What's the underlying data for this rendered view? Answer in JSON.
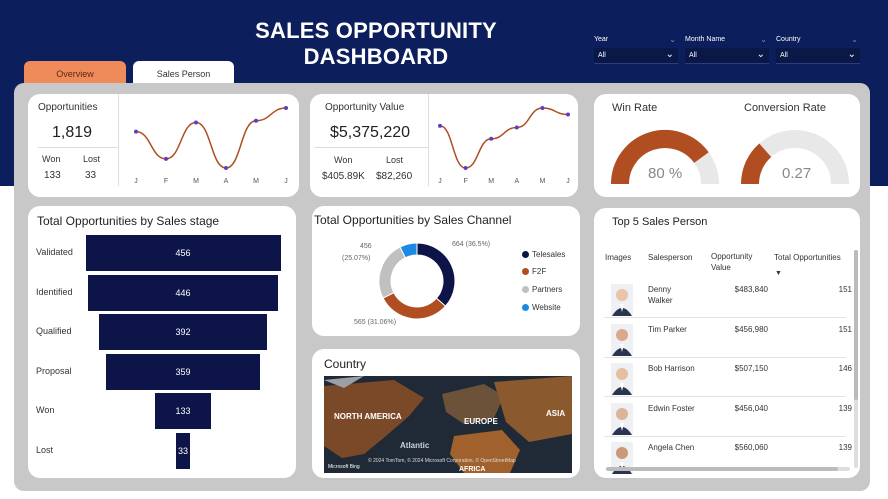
{
  "header": {
    "title": "SALES OPPORTUNITY DASHBOARD"
  },
  "filters": [
    {
      "label": "Year",
      "value": "All"
    },
    {
      "label": "Month Name",
      "value": "All"
    },
    {
      "label": "Country",
      "value": "All"
    }
  ],
  "tabs": {
    "overview": "Overview",
    "sales_person": "Sales Person"
  },
  "opportunities": {
    "title": "Opportunities",
    "value": "1,819",
    "won_label": "Won",
    "won_value": "133",
    "lost_label": "Lost",
    "lost_value": "33"
  },
  "opportunity_value": {
    "title": "Opportunity Value",
    "value": "$5,375,220",
    "won_label": "Won",
    "won_value": "$405.89K",
    "lost_label": "Lost",
    "lost_value": "$82,260"
  },
  "rates": {
    "win_title": "Win Rate",
    "win_value": "80 %",
    "win_fraction": 0.8,
    "conv_title": "Conversion Rate",
    "conv_value": "0.27",
    "conv_fraction": 0.27
  },
  "funnel": {
    "title": "Total Opportunities by Sales stage",
    "stages": [
      {
        "label": "Validated",
        "value": "456"
      },
      {
        "label": "Identified",
        "value": "446"
      },
      {
        "label": "Qualified",
        "value": "392"
      },
      {
        "label": "Proposal",
        "value": "359"
      },
      {
        "label": "Won",
        "value": "133"
      },
      {
        "label": "Lost",
        "value": "33"
      }
    ]
  },
  "channel": {
    "title": "Total Opportunities by Sales Channel",
    "label_top_right": "664 (36.5%)",
    "label_top_left_1": "456",
    "label_top_left_2": "(25.07%)",
    "label_bottom": "565 (31.06%)",
    "legend": [
      "Telesales",
      "F2F",
      "Partners",
      "Website"
    ]
  },
  "country": {
    "title": "Country",
    "labels": {
      "na": "NORTH AMERICA",
      "eu": "EUROPE",
      "as": "ASIA",
      "at": "Atlantic",
      "af": "AFRICA"
    },
    "attribution": "© 2024 TomTom, © 2024 Microsoft Corporation, © OpenStreetMap",
    "logo": "Microsoft Bing"
  },
  "top5": {
    "title": "Top 5 Sales Person",
    "headers": {
      "images": "Images",
      "salesperson": "Salesperson",
      "value_1": "Opportunity",
      "value_2": "Value",
      "total": "Total Opportunities"
    },
    "rows": [
      {
        "name_1": "Denny",
        "name_2": "Walker",
        "value": "$483,840",
        "total": "151"
      },
      {
        "name_1": "Tim Parker",
        "name_2": "",
        "value": "$456,980",
        "total": "151"
      },
      {
        "name_1": "Bob Harrison",
        "name_2": "",
        "value": "$507,150",
        "total": "146"
      },
      {
        "name_1": "Edwin Foster",
        "name_2": "",
        "value": "$456,040",
        "total": "139"
      },
      {
        "name_1": "Angela Chen",
        "name_2": "",
        "value": "$560,060",
        "total": "139"
      }
    ]
  },
  "month_axis": [
    "J",
    "F",
    "M",
    "A",
    "M",
    "J"
  ],
  "colors": {
    "navy": "#0c1e5b",
    "orange_tab": "#ef8b5b",
    "rust": "#b04d21",
    "funnel": "#0c1448",
    "donut": [
      "#0c1448",
      "#b04d21",
      "#c0c0c0",
      "#1e88e5"
    ]
  },
  "chart_data": [
    {
      "type": "line",
      "title": "",
      "categories": [
        "J",
        "F",
        "M",
        "A",
        "M",
        "J"
      ],
      "series": [
        {
          "values": [
            305,
            290,
            310,
            285,
            311,
            318
          ]
        }
      ]
    },
    {
      "type": "line",
      "title": "",
      "categories": [
        "J",
        "F",
        "M",
        "A",
        "M",
        "J"
      ],
      "series": [
        {
          "values": [
            910,
            780,
            870,
            905,
            965,
            945
          ]
        }
      ]
    },
    {
      "type": "pie",
      "title": "Total Opportunities by Sales Channel",
      "categories": [
        "Telesales",
        "F2F",
        "Partners",
        "Website"
      ],
      "values": [
        664,
        565,
        456,
        134
      ]
    },
    {
      "type": "bar",
      "title": "Total Opportunities by Sales stage",
      "categories": [
        "Validated",
        "Identified",
        "Qualified",
        "Proposal",
        "Won",
        "Lost"
      ],
      "values": [
        456,
        446,
        392,
        359,
        133,
        33
      ]
    }
  ]
}
